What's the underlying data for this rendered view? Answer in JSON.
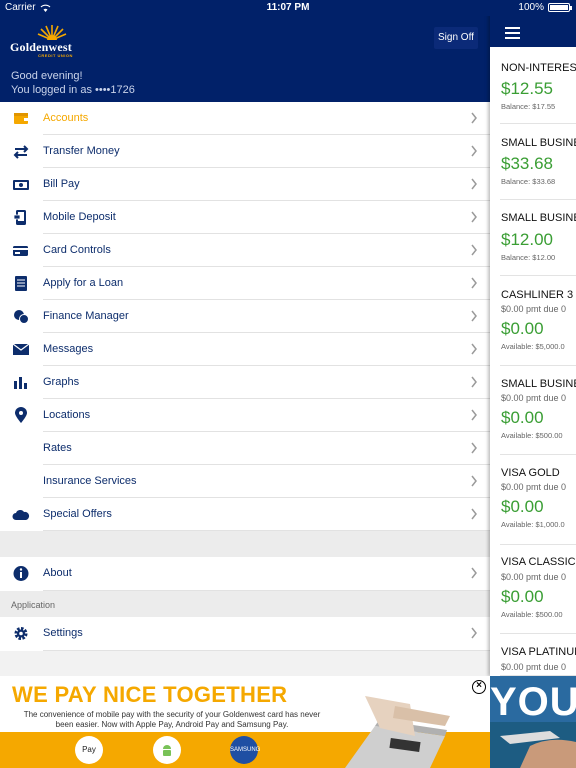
{
  "status_bar": {
    "carrier": "Carrier",
    "time": "11:07 PM",
    "battery": "100%"
  },
  "header": {
    "logo_name": "Goldenwest",
    "logo_sub": "CREDIT UNION",
    "sign_off_label": "Sign Off",
    "greeting": "Good evening!",
    "logged_in": "You logged in as ••••1726"
  },
  "menu": {
    "items": [
      {
        "label": "Accounts",
        "icon": "wallet-icon",
        "active": true
      },
      {
        "label": "Transfer Money",
        "icon": "transfer-arrows-icon"
      },
      {
        "label": "Bill Pay",
        "icon": "bill-icon"
      },
      {
        "label": "Mobile Deposit",
        "icon": "mobile-deposit-icon"
      },
      {
        "label": "Card Controls",
        "icon": "card-icon"
      },
      {
        "label": "Apply for a Loan",
        "icon": "loan-document-icon"
      },
      {
        "label": "Finance Manager",
        "icon": "coins-icon"
      },
      {
        "label": "Messages",
        "icon": "envelope-icon"
      },
      {
        "label": "Graphs",
        "icon": "bar-chart-icon"
      },
      {
        "label": "Locations",
        "icon": "location-pin-icon"
      },
      {
        "label": "Rates",
        "icon": ""
      },
      {
        "label": "Insurance Services",
        "icon": ""
      },
      {
        "label": "Special Offers",
        "icon": "cloud-icon"
      }
    ],
    "about_label": "About",
    "application_section": "Application",
    "settings_label": "Settings"
  },
  "accounts": [
    {
      "name": "NON-INTEREST",
      "pmt": "",
      "amount": "$12.55",
      "balance": "Balance: $17.55"
    },
    {
      "name": "SMALL BUSINESS",
      "pmt": "",
      "amount": "$33.68",
      "balance": "Balance: $33.68"
    },
    {
      "name": "SMALL BUSINESS",
      "pmt": "",
      "amount": "$12.00",
      "balance": "Balance: $12.00"
    },
    {
      "name": "CASHLINER 3",
      "pmt": "$0.00 pmt due 0",
      "amount": "$0.00",
      "balance": "Available: $5,000.0"
    },
    {
      "name": "SMALL BUSINESS",
      "pmt": "$0.00 pmt due 0",
      "amount": "$0.00",
      "balance": "Available: $500.00"
    },
    {
      "name": "VISA GOLD",
      "pmt": "$0.00 pmt due 0",
      "amount": "$0.00",
      "balance": "Available: $1,000.0"
    },
    {
      "name": "VISA CLASSIC",
      "pmt": "$0.00 pmt due 0",
      "amount": "$0.00",
      "balance": "Available: $500.00"
    },
    {
      "name": "VISA PLATINUM",
      "pmt": "$0.00 pmt due 0",
      "amount": "",
      "balance": ""
    }
  ],
  "ad": {
    "headline": "WE PAY NICE TOGETHER",
    "copy": "The convenience of mobile pay with the security of your Goldenwest card has never been easier. Now with Apple Pay, Android Pay and Samsung Pay.",
    "apple_pay": " Pay",
    "samsung_pay": "SAMSUNG pay",
    "close": "×",
    "side_text": "YOU"
  },
  "colors": {
    "navy": "#012169",
    "gold": "#f5a800",
    "green": "#3a9e34"
  }
}
